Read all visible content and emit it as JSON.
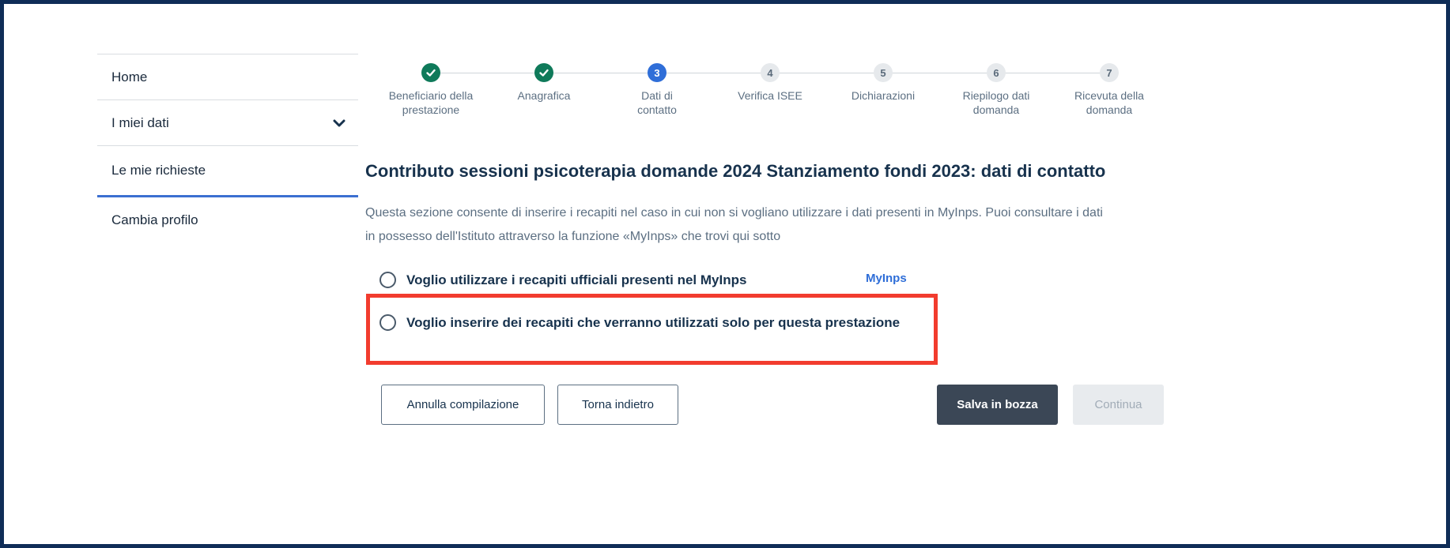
{
  "sidebar": {
    "items": [
      {
        "label": "Home"
      },
      {
        "label": "I miei dati"
      },
      {
        "label": "Le mie richieste"
      },
      {
        "label": "Cambia profilo"
      }
    ]
  },
  "stepper": {
    "steps": [
      {
        "marker": "",
        "status": "done",
        "label": "Beneficiario della prestazione"
      },
      {
        "marker": "",
        "status": "done",
        "label": "Anagrafica"
      },
      {
        "marker": "3",
        "status": "current",
        "label": "Dati di contatto"
      },
      {
        "marker": "4",
        "status": "future",
        "label": "Verifica ISEE"
      },
      {
        "marker": "5",
        "status": "future",
        "label": "Dichiarazioni"
      },
      {
        "marker": "6",
        "status": "future",
        "label": "Riepilogo dati domanda"
      },
      {
        "marker": "7",
        "status": "future",
        "label": "Ricevuta della domanda"
      }
    ]
  },
  "main": {
    "title": "Contributo sessioni psicoterapia domande 2024 Stanziamento fondi 2023: dati di contatto",
    "description": "Questa sezione consente di inserire i recapiti nel caso in cui non si vogliano utilizzare i dati presenti in MyInps. Puoi consultare i dati in possesso dell'Istituto attraverso la funzione «MyInps» che trovi qui sotto",
    "options": [
      {
        "label": "Voglio utilizzare i recapiti ufficiali presenti nel MyInps"
      },
      {
        "label": "Voglio inserire dei recapiti che verranno utilizzati solo per questa prestazione"
      }
    ],
    "mylnps_link": "MyInps"
  },
  "buttons": {
    "cancel": "Annulla compilazione",
    "back": "Torna indietro",
    "save_draft": "Salva in bozza",
    "continue": "Continua"
  },
  "colors": {
    "done": "#0f7a5a",
    "current": "#2f6ed8",
    "highlight": "#f23c2e",
    "frame": "#0f2d57"
  }
}
